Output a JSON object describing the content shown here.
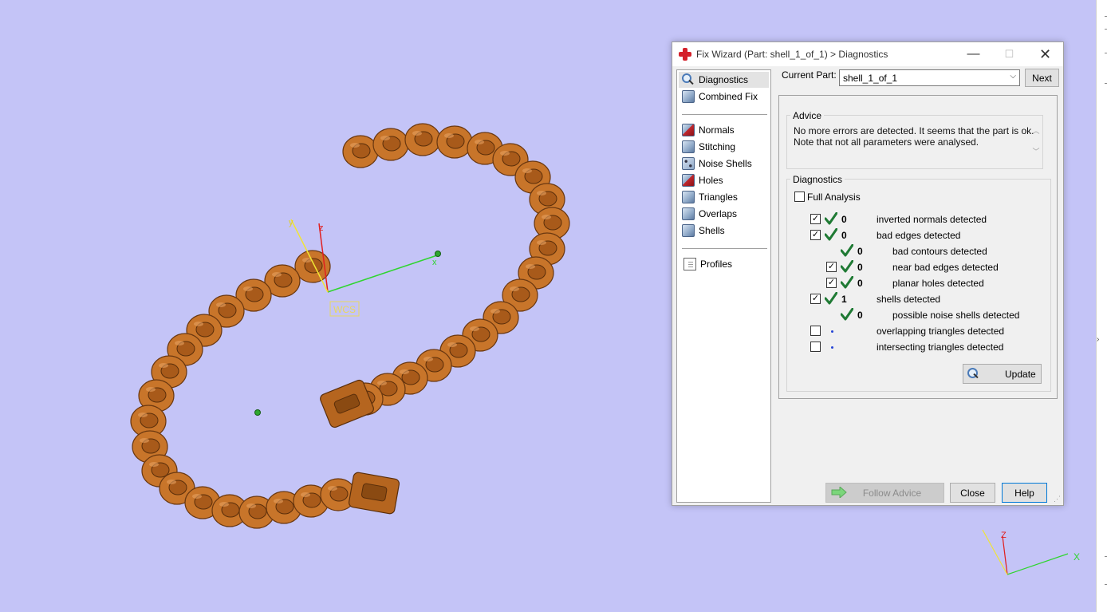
{
  "viewport": {
    "wcs_label": "WCS",
    "axis_x": "x",
    "axis_y": "y",
    "axis_z": "z",
    "mini_axis_x": "X",
    "mini_axis_z": "Z",
    "mini_axis_y": "Y",
    "model_color": "#c8752a",
    "background_color": "#c4c4f7"
  },
  "dialog": {
    "title": "Fix Wizard (Part: shell_1_of_1) > Diagnostics",
    "minimize_glyph": "—",
    "maximize_glyph": "☐",
    "close_glyph": "✕",
    "sidebar": {
      "group1": [
        {
          "label": "Diagnostics",
          "icon": "magnifier-icon",
          "selected": true
        },
        {
          "label": "Combined Fix",
          "icon": "cube-icon"
        }
      ],
      "group2": [
        {
          "label": "Normals",
          "icon": "normals-cube-icon"
        },
        {
          "label": "Stitching",
          "icon": "cube-icon"
        },
        {
          "label": "Noise Shells",
          "icon": "noise-cube-icon"
        },
        {
          "label": "Holes",
          "icon": "holes-cube-icon"
        },
        {
          "label": "Triangles",
          "icon": "cube-icon"
        },
        {
          "label": "Overlaps",
          "icon": "cube-icon"
        },
        {
          "label": "Shells",
          "icon": "cube-icon"
        }
      ],
      "group3": [
        {
          "label": "Profiles",
          "icon": "document-icon"
        }
      ]
    },
    "current_part_label": "Current Part:",
    "current_part_value": "shell_1_of_1",
    "next_label": "Next",
    "advice_title": "Advice",
    "advice_line1": "No more errors are detected. It seems that the part is ok.",
    "advice_line2": "Note that not all parameters were analysed.",
    "diagnostics_title": "Diagnostics",
    "full_analysis_label": "Full Analysis",
    "full_analysis_checked": false,
    "rows": [
      {
        "label": "inverted normals detected",
        "count": "0",
        "checkbox": true,
        "checked": true,
        "status": "ok",
        "indent": 0
      },
      {
        "label": "bad edges detected",
        "count": "0",
        "checkbox": true,
        "checked": true,
        "status": "ok",
        "indent": 0
      },
      {
        "label": "bad contours detected",
        "count": "0",
        "checkbox": false,
        "checked": false,
        "status": "ok",
        "indent": 1
      },
      {
        "label": "near bad edges detected",
        "count": "0",
        "checkbox": true,
        "checked": true,
        "status": "ok",
        "indent": 1
      },
      {
        "label": "planar holes detected",
        "count": "0",
        "checkbox": true,
        "checked": true,
        "status": "ok",
        "indent": 1
      },
      {
        "label": "shells detected",
        "count": "1",
        "checkbox": true,
        "checked": true,
        "status": "ok",
        "indent": 0
      },
      {
        "label": "possible noise shells detected",
        "count": "0",
        "checkbox": false,
        "checked": false,
        "status": "ok",
        "indent": 1
      },
      {
        "label": "overlapping triangles detected",
        "count": "",
        "checkbox": true,
        "checked": false,
        "status": "pending",
        "indent": 0
      },
      {
        "label": "intersecting triangles detected",
        "count": "",
        "checkbox": true,
        "checked": false,
        "status": "pending",
        "indent": 0
      }
    ],
    "update_label": "Update",
    "follow_advice_label": "Follow Advice",
    "close_label": "Close",
    "help_label": "Help",
    "check_color": "#1f7a34",
    "pending_dot_color": "#2544d6"
  }
}
